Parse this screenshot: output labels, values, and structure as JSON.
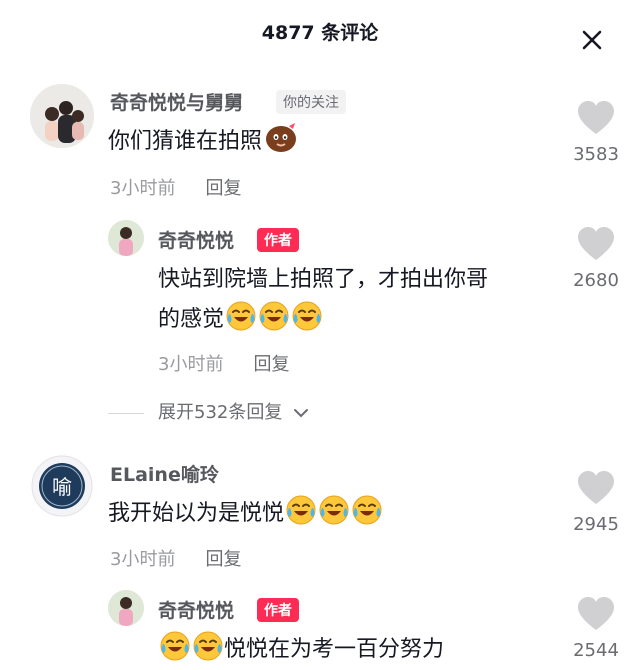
{
  "header": {
    "title": "4877 条评论"
  },
  "comments": [
    {
      "username": "奇奇悦悦与舅舅",
      "badge": "你的关注",
      "text": "你们猜谁在拍照",
      "time": "3小时前",
      "reply_label": "回复",
      "likes": "3583",
      "emoji_icons": [
        "bean-face-emoji-icon"
      ],
      "replies": [
        {
          "username": "奇奇悦悦",
          "badge": "作者",
          "text_line1": "快站到院墙上拍照了，才拍出你哥",
          "text_line2": "的感觉",
          "time": "3小时前",
          "reply_label": "回复",
          "likes": "2680",
          "emoji_icons": [
            "laugh-cry-emoji-icon",
            "laugh-cry-emoji-icon",
            "laugh-cry-emoji-icon"
          ]
        }
      ],
      "expand_label": "展开532条回复"
    },
    {
      "username": "ELaine喻玲",
      "text": "我开始以为是悦悦",
      "time": "3小时前",
      "reply_label": "回复",
      "likes": "2945",
      "emoji_icons": [
        "laugh-cry-emoji-icon",
        "laugh-cry-emoji-icon",
        "laugh-cry-emoji-icon"
      ],
      "avatar_text": "喻",
      "replies": [
        {
          "username": "奇奇悦悦",
          "badge": "作者",
          "text": "悦悦在为考一百分努力",
          "likes": "2544",
          "emoji_icons": [
            "laugh-cry-emoji-icon",
            "laugh-cry-emoji-icon"
          ]
        }
      ]
    }
  ],
  "colors": {
    "author_badge": "#fe2c55",
    "heart": "#d0d0d2",
    "username": "#57585e"
  }
}
